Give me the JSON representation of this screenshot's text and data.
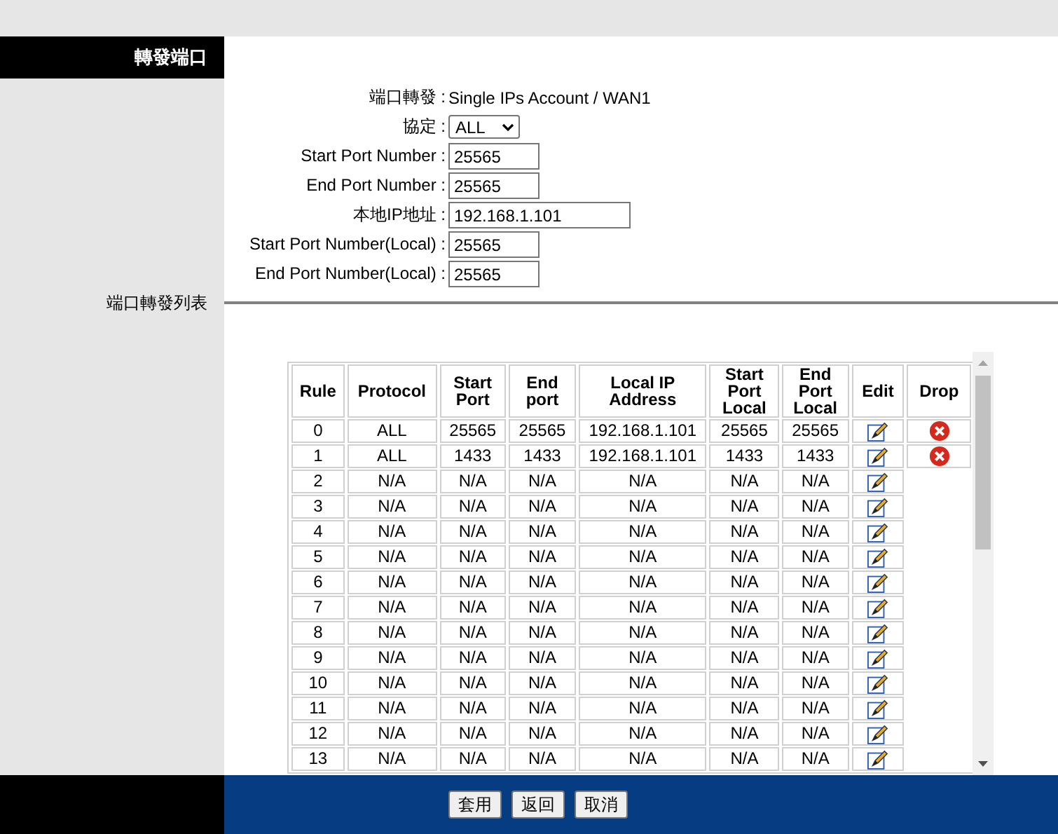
{
  "sidebar": {
    "header": "轉發端口",
    "section_label": "端口轉發列表"
  },
  "form": {
    "account": {
      "label": "端口轉發 :",
      "value": "Single IPs Account / WAN1"
    },
    "fields": [
      {
        "kind": "select",
        "label": "協定 :",
        "value": "ALL"
      },
      {
        "kind": "input",
        "label": "Start Port Number :",
        "value": "25565"
      },
      {
        "kind": "input",
        "label": "End Port Number :",
        "value": "25565"
      },
      {
        "kind": "wide_input",
        "label": "本地IP地址 :",
        "value": "192.168.1.101"
      },
      {
        "kind": "input",
        "label": "Start Port Number(Local) :",
        "value": "25565"
      },
      {
        "kind": "input",
        "label": "End Port Number(Local) :",
        "value": "25565"
      }
    ]
  },
  "table": {
    "columns": [
      "Rule",
      "Protocol",
      "Start Port",
      "End port",
      "Local IP Address",
      "Start Port Local",
      "End Port Local",
      "Edit",
      "Drop"
    ],
    "rows": [
      {
        "cells": [
          "0",
          "ALL",
          "25565",
          "25565",
          "192.168.1.101",
          "25565",
          "25565"
        ],
        "droppable": true
      },
      {
        "cells": [
          "1",
          "ALL",
          "1433",
          "1433",
          "192.168.1.101",
          "1433",
          "1433"
        ],
        "droppable": true
      },
      {
        "cells": [
          "2",
          "N/A",
          "N/A",
          "N/A",
          "N/A",
          "N/A",
          "N/A"
        ],
        "droppable": false
      },
      {
        "cells": [
          "3",
          "N/A",
          "N/A",
          "N/A",
          "N/A",
          "N/A",
          "N/A"
        ],
        "droppable": false
      },
      {
        "cells": [
          "4",
          "N/A",
          "N/A",
          "N/A",
          "N/A",
          "N/A",
          "N/A"
        ],
        "droppable": false
      },
      {
        "cells": [
          "5",
          "N/A",
          "N/A",
          "N/A",
          "N/A",
          "N/A",
          "N/A"
        ],
        "droppable": false
      },
      {
        "cells": [
          "6",
          "N/A",
          "N/A",
          "N/A",
          "N/A",
          "N/A",
          "N/A"
        ],
        "droppable": false
      },
      {
        "cells": [
          "7",
          "N/A",
          "N/A",
          "N/A",
          "N/A",
          "N/A",
          "N/A"
        ],
        "droppable": false
      },
      {
        "cells": [
          "8",
          "N/A",
          "N/A",
          "N/A",
          "N/A",
          "N/A",
          "N/A"
        ],
        "droppable": false
      },
      {
        "cells": [
          "9",
          "N/A",
          "N/A",
          "N/A",
          "N/A",
          "N/A",
          "N/A"
        ],
        "droppable": false
      },
      {
        "cells": [
          "10",
          "N/A",
          "N/A",
          "N/A",
          "N/A",
          "N/A",
          "N/A"
        ],
        "droppable": false
      },
      {
        "cells": [
          "11",
          "N/A",
          "N/A",
          "N/A",
          "N/A",
          "N/A",
          "N/A"
        ],
        "droppable": false
      },
      {
        "cells": [
          "12",
          "N/A",
          "N/A",
          "N/A",
          "N/A",
          "N/A",
          "N/A"
        ],
        "droppable": false
      },
      {
        "cells": [
          "13",
          "N/A",
          "N/A",
          "N/A",
          "N/A",
          "N/A",
          "N/A"
        ],
        "droppable": false
      }
    ]
  },
  "buttons": [
    "套用",
    "返回",
    "取消"
  ]
}
